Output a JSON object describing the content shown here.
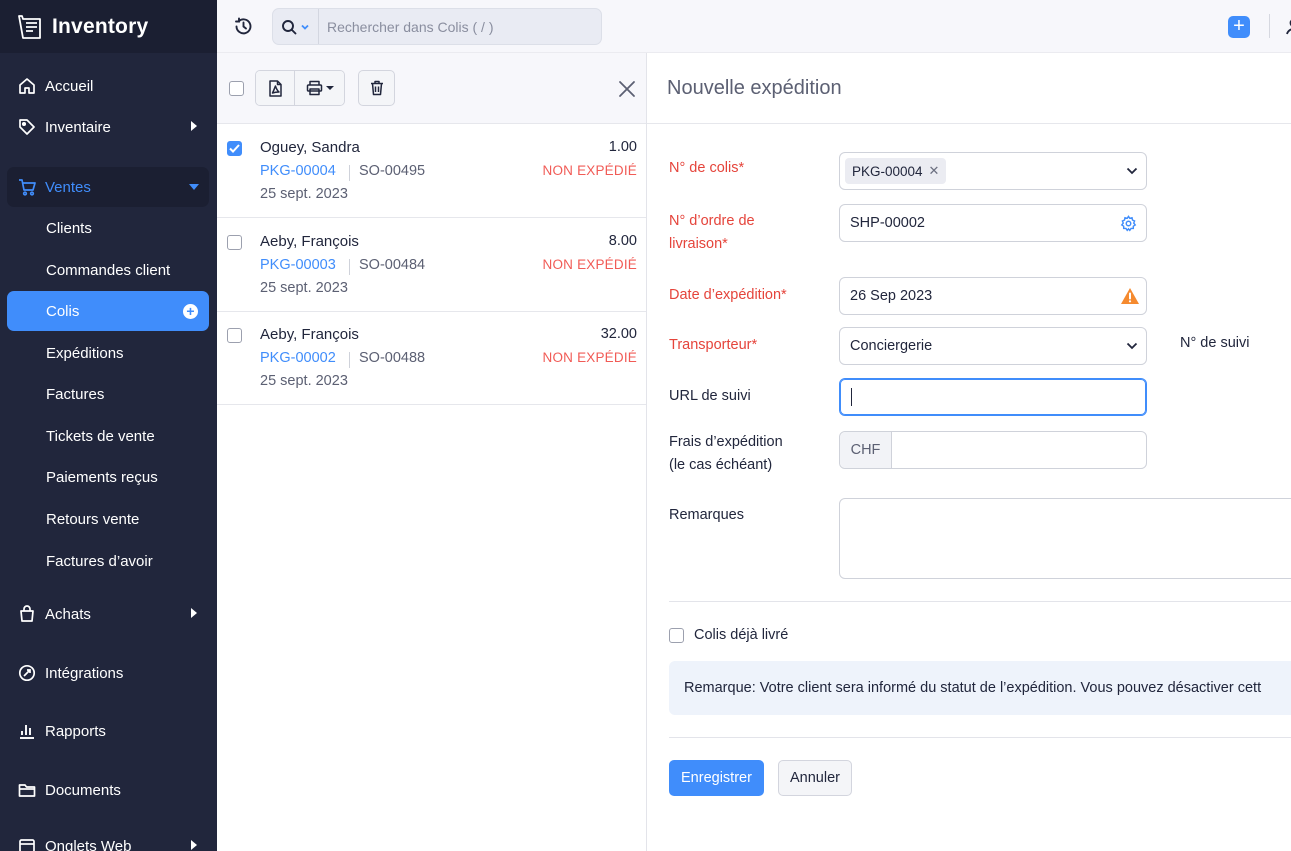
{
  "app": {
    "title": "Inventory"
  },
  "sidebar": {
    "items": [
      {
        "label": "Accueil",
        "icon": "home-icon"
      },
      {
        "label": "Inventaire",
        "icon": "tag-icon"
      },
      {
        "label": "Ventes",
        "icon": "cart-icon"
      },
      {
        "label": "Achats",
        "icon": "bag-icon"
      },
      {
        "label": "Intégrations",
        "icon": "integration-icon"
      },
      {
        "label": "Rapports",
        "icon": "chart-icon"
      },
      {
        "label": "Documents",
        "icon": "folder-icon"
      },
      {
        "label": "Onglets Web",
        "icon": "web-tab-icon"
      }
    ],
    "sales_sub": [
      {
        "label": "Clients"
      },
      {
        "label": "Commandes client"
      },
      {
        "label": "Colis"
      },
      {
        "label": "Expéditions"
      },
      {
        "label": "Factures"
      },
      {
        "label": "Tickets de vente"
      },
      {
        "label": "Paiements reçus"
      },
      {
        "label": "Retours vente"
      },
      {
        "label": "Factures d’avoir"
      }
    ],
    "active_sub": "Colis",
    "accent": "#408dfb",
    "background": "#21263c"
  },
  "topbar": {
    "search_placeholder": "Rechercher dans Colis ( / )"
  },
  "list": {
    "rows": [
      {
        "customer": "Oguey, Sandra",
        "package": "PKG-00004",
        "order": "SO-00495",
        "date": "25 sept. 2023",
        "quantity": "1.00",
        "status": "NON EXPÉDIÉ",
        "checked": true
      },
      {
        "customer": "Aeby, François",
        "package": "PKG-00003",
        "order": "SO-00484",
        "date": "25 sept. 2023",
        "quantity": "8.00",
        "status": "NON EXPÉDIÉ",
        "checked": false
      },
      {
        "customer": "Aeby, François",
        "package": "PKG-00002",
        "order": "SO-00488",
        "date": "25 sept. 2023",
        "quantity": "32.00",
        "status": "NON EXPÉDIÉ",
        "checked": false
      }
    ]
  },
  "form": {
    "title": "Nouvelle expédition",
    "package_label": "N° de colis*",
    "package_chip": "PKG-00004",
    "delivery_order_label_1": "N° d’ordre de",
    "delivery_order_label_2": "livraison*",
    "delivery_order_value": "SHP-00002",
    "ship_date_label": "Date d’expédition*",
    "ship_date_value": "26 Sep 2023",
    "carrier_label": "Transporteur*",
    "carrier_value": "Conciergerie",
    "tracking_no_label": "N° de suivi",
    "tracking_url_label": "URL de suivi",
    "tracking_url_value": "",
    "shipping_fee_label_1": "Frais d’expédition",
    "shipping_fee_label_2": "(le cas échéant)",
    "currency": "CHF",
    "shipping_fee_value": "",
    "notes_label": "Remarques",
    "delivered_label": "Colis déjà livré",
    "delivered_checked": false,
    "notice": "Remarque: Votre client sera informé du statut de l’expédition. Vous pouvez désactiver cett",
    "save_label": "Enregistrer",
    "cancel_label": "Annuler",
    "required_color": "#e5443b",
    "warning_color": "#f58a2f"
  }
}
